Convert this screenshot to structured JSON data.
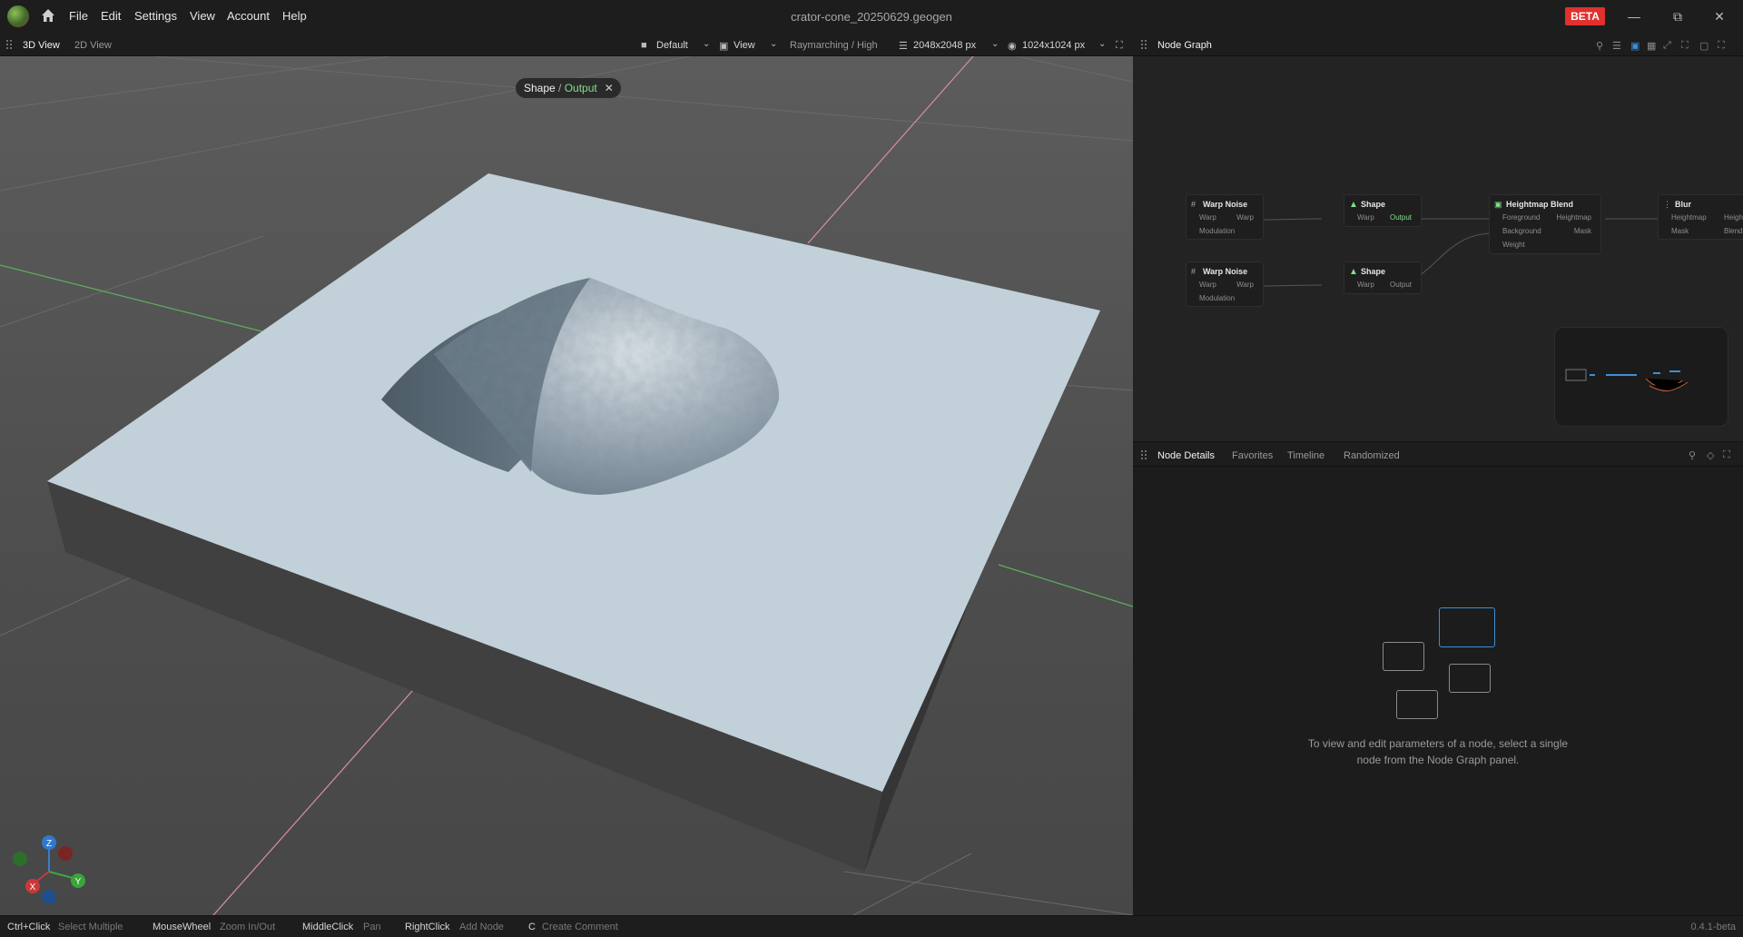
{
  "titlebar": {
    "menu": [
      "File",
      "Edit",
      "Settings",
      "View",
      "Account",
      "Help"
    ],
    "title": "crator-cone_20250629.geogen",
    "badge": "BETA",
    "window_controls": [
      "minimize-icon",
      "restore-icon",
      "close-icon"
    ]
  },
  "view_toolbar": {
    "tabs": [
      "3D View",
      "2D View"
    ],
    "active_tab": "3D View",
    "preset": "Default",
    "view_menu": "View",
    "render_mode": "Raymarching / High",
    "resolution": "2048x2048 px",
    "preview_resolution": "1024x1024 px"
  },
  "viewport": {
    "breadcrumb": {
      "node": "Shape",
      "separator": " / ",
      "output": "Output"
    },
    "gizmo": {
      "z": "Z",
      "y": "Y",
      "x": "X"
    }
  },
  "node_graph": {
    "title": "Node Graph",
    "nodes": [
      {
        "title": "Warp Noise",
        "inputs": [
          "Warp",
          "Modulation"
        ],
        "outputs": [
          "Warp"
        ]
      },
      {
        "title": "Warp Noise",
        "inputs": [
          "Warp",
          "Modulation"
        ],
        "outputs": [
          "Warp"
        ]
      },
      {
        "title": "Shape",
        "inputs": [
          "Warp"
        ],
        "outputs": [
          "Output"
        ]
      },
      {
        "title": "Shape",
        "inputs": [
          "Warp"
        ],
        "outputs": [
          "Output"
        ]
      },
      {
        "title": "Heightmap Blend",
        "inputs": [
          "Foreground",
          "Background",
          "Weight"
        ],
        "outputs": [
          "Heightmap",
          "Mask"
        ]
      },
      {
        "title": "Blur",
        "inputs": [
          "Heightmap",
          "Mask"
        ],
        "outputs": [
          "Height",
          "Blending"
        ]
      }
    ],
    "accent": "#7fe08a"
  },
  "node_details": {
    "tabs": [
      "Node Details",
      "Favorites",
      "Timeline",
      "Randomized"
    ],
    "active_tab": "Node Details",
    "hint_line1": "To view and edit parameters of a node, select a single",
    "hint_line2": "node from the Node Graph panel."
  },
  "statusbar": {
    "hotkeys": [
      {
        "key": "Ctrl+Click",
        "desc": "Select Multiple"
      },
      {
        "key": "MouseWheel",
        "desc": "Zoom In/Out"
      },
      {
        "key": "MiddleClick",
        "desc": "Pan"
      },
      {
        "key": "RightClick",
        "desc": "Add Node"
      },
      {
        "key": "C",
        "desc": "Create Comment"
      }
    ],
    "version": "0.4.1-beta"
  }
}
